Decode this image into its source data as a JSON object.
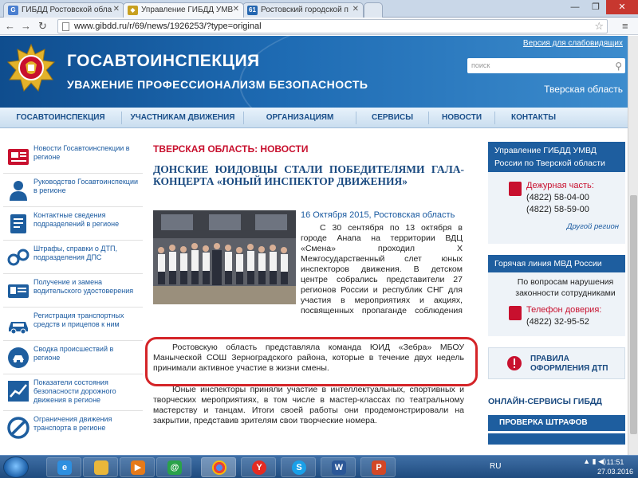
{
  "browser": {
    "tabs": [
      {
        "title": "ГИБДД Ростовской обла",
        "favicon": "G"
      },
      {
        "title": "Управление ГИБДД УМВ",
        "favicon": "◆"
      },
      {
        "title": "Ростовский городской п",
        "favicon": "61"
      }
    ],
    "url": "www.gibdd.ru/r/69/news/1926253/?type=original"
  },
  "header": {
    "title": "ГОСАВТОИНСПЕКЦИЯ",
    "slogan": "УВАЖЕНИЕ  ПРОФЕССИОНАЛИЗМ  БЕЗОПАСНОСТЬ",
    "low_vision_link": "Версия для слабовидящих",
    "search_placeholder": "поиск",
    "region": "Тверская область"
  },
  "nav": [
    "ГОСАВТОИНСПЕКЦИЯ",
    "УЧАСТНИКАМ ДВИЖЕНИЯ",
    "ОРГАНИЗАЦИЯМ",
    "СЕРВИСЫ",
    "НОВОСТИ",
    "КОНТАКТЫ"
  ],
  "sidebar": {
    "items": [
      {
        "label": "Новости Госавтоинспекции в регионе",
        "icon": "newspaper-icon"
      },
      {
        "label": "Руководство Госавтоинспекции в регионе",
        "icon": "person-icon"
      },
      {
        "label": "Контактные сведения подразделений в регионе",
        "icon": "contacts-icon"
      },
      {
        "label": "Штрафы, справки о ДТП, подразделения ДПС",
        "icon": "handcuffs-icon"
      },
      {
        "label": "Получение и замена водительского удостоверения",
        "icon": "license-icon"
      },
      {
        "label": "Регистрация транспортных средств и прицепов к ним",
        "icon": "car-icon"
      },
      {
        "label": "Сводка происшествий в регионе",
        "icon": "crash-icon"
      },
      {
        "label": "Показатели состояния безопасности дорожного движения в регионе",
        "icon": "chart-icon"
      },
      {
        "label": "Ограничения движения транспорта в регионе",
        "icon": "no-entry-icon"
      }
    ]
  },
  "article": {
    "section": "ТВЕРСКАЯ ОБЛАСТЬ: НОВОСТИ",
    "title": "ДОНСКИЕ ЮИДОВЦЫ СТАЛИ ПОБЕДИТЕЛЯМИ ГАЛА-КОНЦЕРТА «ЮНЫЙ ИНСПЕКТОР ДВИЖЕНИЯ»",
    "date": "16 Октября 2015, Ростовская область",
    "para1": "С 30 сентября по 13 октября в городе Анапа на территории ВДЦ «Смена» проходил X Межгосударственный слет юных инспекторов движения. В детском центре собрались представители 27 регионов России и республик СНГ для участия в мероприятиях и акциях, посвященных пропаганде соблюдения правил дорожного движения.",
    "para2": "Ростовскую область представляла команда ЮИД «Зебра» МБОУ Маныческой СОШ Зерноградского района, которые в течение двух недель принимали активное участие в жизни смены.",
    "para3": "Юные инспекторы приняли участие в интеллектуальных, спортивных и творческих мероприятиях, в том числе в мастер-классах по театральному мастерству и танцам. Итоги своей работы они продемонстрировали на закрытии, представив зрителям свои творческие номера."
  },
  "right": {
    "dept_title": "Управление ГИБДД УМВД России по Тверской области",
    "duty_label": "Дежурная часть:",
    "phone1": "(4822) 58-04-00",
    "phone2": "(4822) 58-59-00",
    "other_region": "Другой регион",
    "hotline_title": "Горячая линия МВД России",
    "hotline_text": "По вопросам нарушения законности сотрудниками",
    "trust_label": "Телефон доверия:",
    "trust_phone": "(4822) 32-95-52",
    "rules_button": "ПРАВИЛА ОФОРМЛЕНИЯ ДТП",
    "services_title": "ОНЛАЙН-СЕРВИСЫ ГИБДД",
    "fines_button": "ПРОВЕРКА ШТРАФОВ"
  },
  "taskbar": {
    "lang": "RU",
    "time": "11:51",
    "date": "27.03.2016"
  }
}
